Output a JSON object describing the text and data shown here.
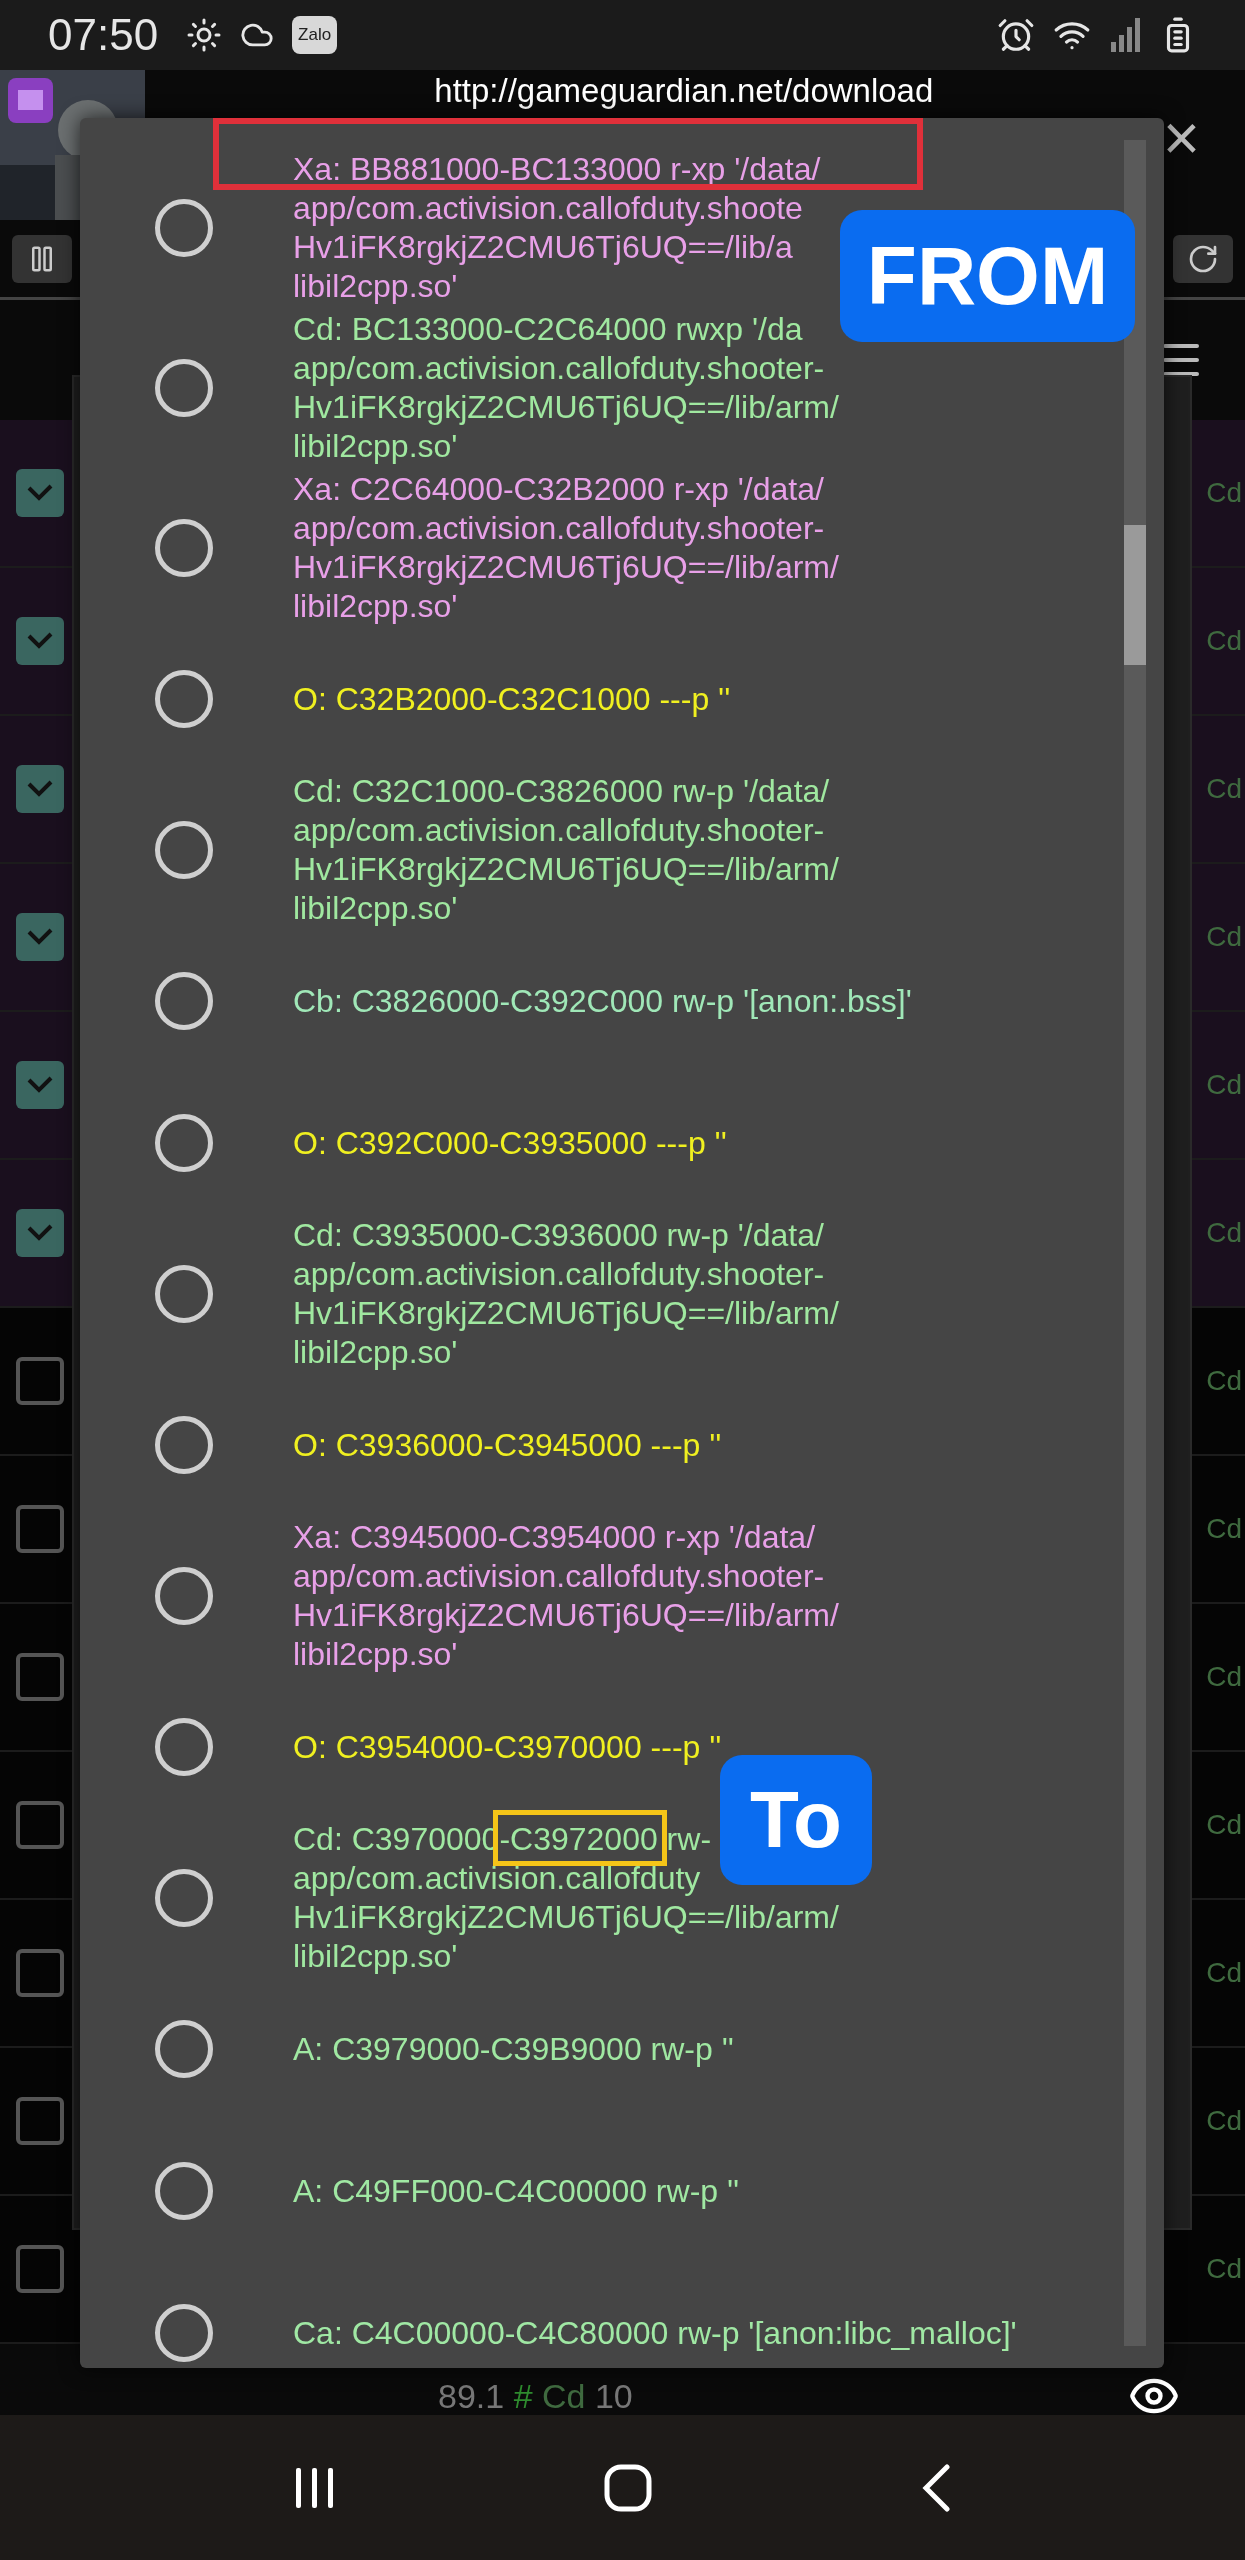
{
  "status_bar": {
    "time": "07:50",
    "app_badge": "Zalo"
  },
  "app": {
    "url": "http://gameguardian.net/download",
    "close": "×",
    "rows": [
      {
        "checked": true,
        "label": "Cd"
      },
      {
        "checked": true,
        "label": "Cd"
      },
      {
        "checked": true,
        "label": "Cd"
      },
      {
        "checked": true,
        "label": "Cd"
      },
      {
        "checked": true,
        "label": "Cd"
      },
      {
        "checked": true,
        "label": "Cd"
      },
      {
        "checked": false,
        "label": "Cd"
      },
      {
        "checked": false,
        "label": "Cd"
      },
      {
        "checked": false,
        "label": "Cd"
      },
      {
        "checked": false,
        "label": "Cd"
      },
      {
        "checked": false,
        "label": "Cd"
      },
      {
        "checked": false,
        "label": "Cd"
      },
      {
        "checked": false,
        "label": "Cd"
      }
    ],
    "footer": {
      "value": "89.1",
      "hash": "#",
      "type": "Cd",
      "count": "10"
    }
  },
  "dialog": {
    "items": [
      {
        "selected": false,
        "color": "#e8a0e8",
        "lines": [
          "Xa: BB881000-BC133000 r-xp '/data/",
          "app/com.activision.callofduty.shoote",
          "Hv1iFK8rgkjZ2CMU6Tj6UQ==/lib/a",
          "libil2cpp.so'"
        ]
      },
      {
        "selected": false,
        "color": "#a0e8a0",
        "lines": [
          "Cd: BC133000-C2C64000 rwxp '/da",
          "app/com.activision.callofduty.shooter-",
          "Hv1iFK8rgkjZ2CMU6Tj6UQ==/lib/arm/",
          "libil2cpp.so'"
        ]
      },
      {
        "selected": false,
        "color": "#e8a0e8",
        "lines": [
          "Xa: C2C64000-C32B2000 r-xp '/data/",
          "app/com.activision.callofduty.shooter-",
          "Hv1iFK8rgkjZ2CMU6Tj6UQ==/lib/arm/",
          "libil2cpp.so'"
        ]
      },
      {
        "selected": false,
        "color": "#f0f020",
        "lines": [
          "O: C32B2000-C32C1000 ---p ''"
        ]
      },
      {
        "selected": false,
        "color": "#a0e8a0",
        "lines": [
          "Cd: C32C1000-C3826000 rw-p '/data/",
          "app/com.activision.callofduty.shooter-",
          "Hv1iFK8rgkjZ2CMU6Tj6UQ==/lib/arm/",
          "libil2cpp.so'"
        ]
      },
      {
        "selected": false,
        "color": "#a0e8b8",
        "lines": [
          "Cb: C3826000-C392C000 rw-p '[anon:.bss]'"
        ]
      },
      {
        "selected": false,
        "color": "#f0f020",
        "lines": [
          "O: C392C000-C3935000 ---p ''"
        ]
      },
      {
        "selected": false,
        "color": "#a0e8a0",
        "lines": [
          "Cd: C3935000-C3936000 rw-p '/data/",
          "app/com.activision.callofduty.shooter-",
          "Hv1iFK8rgkjZ2CMU6Tj6UQ==/lib/arm/",
          "libil2cpp.so'"
        ]
      },
      {
        "selected": false,
        "color": "#f0f020",
        "lines": [
          "O: C3936000-C3945000 ---p ''"
        ]
      },
      {
        "selected": false,
        "color": "#e8a0e8",
        "lines": [
          "Xa: C3945000-C3954000 r-xp '/data/",
          "app/com.activision.callofduty.shooter-",
          "Hv1iFK8rgkjZ2CMU6Tj6UQ==/lib/arm/",
          "libil2cpp.so'"
        ]
      },
      {
        "selected": false,
        "color": "#f0f020",
        "lines": [
          "O: C3954000-C3970000 ---p ''"
        ]
      },
      {
        "selected": false,
        "color": "#a0e8a1",
        "lines": [
          "Cd: C3970000-C3972000 rw-",
          "app/com.activision.callofduty",
          "Hv1iFK8rgkjZ2CMU6Tj6UQ==/lib/arm/",
          "libil2cpp.so'"
        ]
      },
      {
        "selected": false,
        "color": "#a0e8a2",
        "lines": [
          "A: C3979000-C39B9000 rw-p ''"
        ]
      },
      {
        "selected": false,
        "color": "#a0e8a3",
        "lines": [
          "A: C49FF000-C4C00000 rw-p ''"
        ]
      },
      {
        "selected": false,
        "color": "#a0e8a4",
        "lines": [
          "Ca: C4C00000-C4C80000 rw-p '[anon:libc_malloc]'"
        ]
      }
    ]
  },
  "annotations": [
    {
      "kind": "box",
      "color": "#e0303a"
    },
    {
      "kind": "label",
      "text": "FROM"
    },
    {
      "kind": "box",
      "color": "#f5c518"
    },
    {
      "kind": "label",
      "text": "To"
    }
  ]
}
